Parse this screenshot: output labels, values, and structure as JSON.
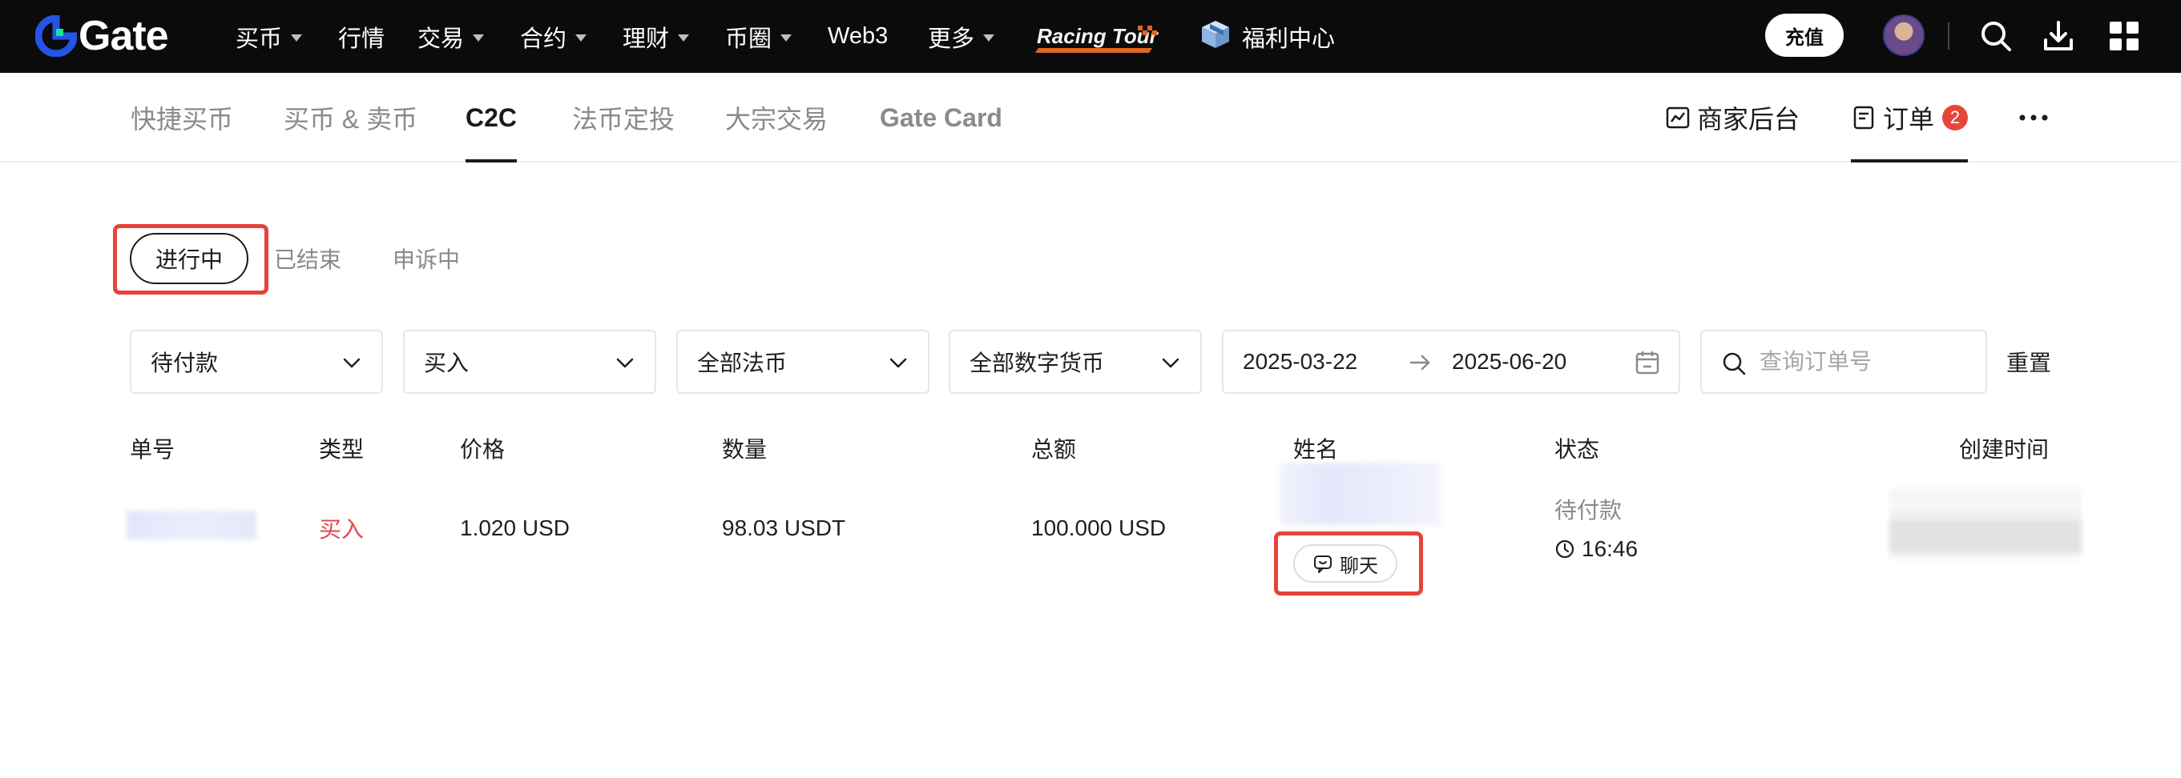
{
  "header": {
    "logo_text": "Gate",
    "nav": [
      {
        "label": "买币",
        "dropdown": true
      },
      {
        "label": "行情",
        "dropdown": false
      },
      {
        "label": "交易",
        "dropdown": true
      },
      {
        "label": "合约",
        "dropdown": true
      },
      {
        "label": "理财",
        "dropdown": true
      },
      {
        "label": "币圈",
        "dropdown": true
      },
      {
        "label": "Web3",
        "dropdown": false
      },
      {
        "label": "更多",
        "dropdown": true
      }
    ],
    "promo_logo_text": "Racing Tour",
    "welfare_label": "福利中心",
    "charge_label": "充值",
    "icons": [
      "search-icon",
      "download-icon",
      "apps-grid-icon"
    ]
  },
  "subnav": {
    "tabs": [
      "快捷买币",
      "买币 & 卖币",
      "C2C",
      "法币定投",
      "大宗交易",
      "Gate Card"
    ],
    "active_tab": "C2C",
    "merchant_label": "商家后台",
    "orders_label": "订单",
    "orders_badge": "2",
    "more_icon": "more-horizontal-icon"
  },
  "status_tabs": {
    "items": [
      "进行中",
      "已结束",
      "申诉中"
    ],
    "active": "进行中"
  },
  "filters": {
    "payment_status": "待付款",
    "side": "买入",
    "fiat": "全部法币",
    "crypto": "全部数字货币",
    "date_from": "2025-03-22",
    "date_to": "2025-06-20",
    "search_placeholder": "查询订单号",
    "reset_label": "重置"
  },
  "table": {
    "headers": [
      "单号",
      "类型",
      "价格",
      "数量",
      "总额",
      "姓名",
      "状态",
      "创建时间"
    ],
    "rows": [
      {
        "type": "买入",
        "price": "1.020 USD",
        "quantity": "98.03 USDT",
        "total": "100.000 USD",
        "chat_label": "聊天",
        "status": "待付款",
        "countdown": "16:46"
      }
    ]
  },
  "colors": {
    "topbar_bg": "#0b0b0c",
    "accent_red": "#e5433a",
    "buy_red": "#e5484d",
    "logo_blue": "#2354e6"
  }
}
